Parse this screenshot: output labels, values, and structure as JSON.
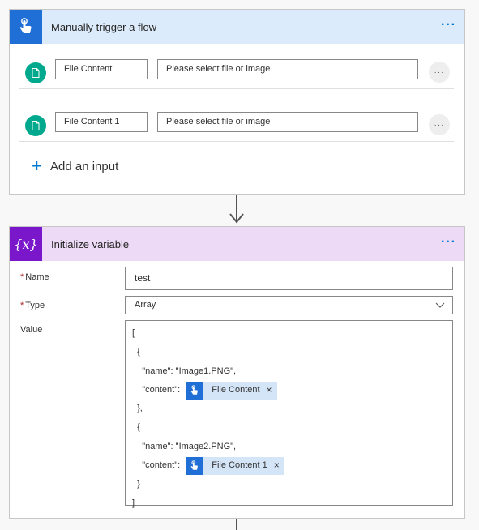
{
  "trigger": {
    "title": "Manually trigger a flow",
    "more": "···",
    "inputs": [
      {
        "name": "File Content",
        "description": "Please select file or image",
        "more": "···"
      },
      {
        "name": "File Content 1",
        "description": "Please select file or image",
        "more": "···"
      }
    ],
    "add_input": {
      "plus": "+",
      "label": "Add an input"
    }
  },
  "variable": {
    "title": "Initialize variable",
    "icon_text": "{x}",
    "more": "···",
    "name_label": "Name",
    "name_value": "test",
    "type_label": "Type",
    "type_value": "Array",
    "value_label": "Value",
    "required_mark": "*",
    "value_lines": {
      "l1": "[",
      "l2": "  {",
      "l3": "    \"name\": \"Image1.PNG\",",
      "l4": "    \"content\": ",
      "l5": "  },",
      "l6": "  {",
      "l7": "    \"name\": \"Image2.PNG\",",
      "l8": "    \"content\": ",
      "l9": "  }",
      "l10": "]"
    },
    "tokens": [
      {
        "label": "File Content",
        "remove": "×"
      },
      {
        "label": "File Content 1",
        "remove": "×"
      }
    ]
  },
  "colors": {
    "trigger_header": "#dcebfb",
    "trigger_icon": "#1f6fd6",
    "variable_header": "#ecdaf6",
    "variable_icon": "#7a17ca",
    "accent": "#0078d4",
    "file_circle": "#00a88e"
  },
  "icons": {
    "trigger": "hand-touch-icon",
    "file": "document-icon",
    "variable": "variable-braces-icon",
    "dropdown": "chevron-down-icon"
  }
}
